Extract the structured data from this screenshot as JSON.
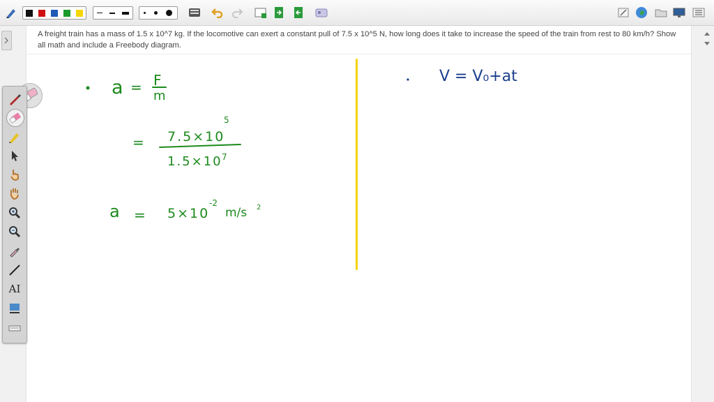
{
  "question": {
    "text": "A freight train has a mass of 1.5 x 10^7 kg. If the locomotive can exert a constant pull of 7.5 x 10^5 N, how long does it take to increase the speed of the train from rest to 80 km/h? Show all math and include a Freebody diagram."
  },
  "toolbar": {
    "colors": [
      "#111111",
      "#d01010",
      "#1f5bb5",
      "#1a9a2a",
      "#f5d600"
    ],
    "icons": [
      "pen-settings-icon",
      "keyboard-icon",
      "undo-icon",
      "redo-icon",
      "new-page-icon",
      "export-page-icon",
      "import-page-icon",
      "gallery-icon",
      "note-icon",
      "globe-icon",
      "folder-icon",
      "screen-icon",
      "menu-icon"
    ]
  },
  "palette": {
    "tools": [
      "pen-icon",
      "eraser-icon",
      "highlighter-icon",
      "pointer-icon",
      "hand-pointer-icon",
      "pan-hand-icon",
      "zoom-in-icon",
      "zoom-out-icon",
      "eyedropper-icon",
      "line-icon",
      "text-tool-icon",
      "image-tool-icon",
      "keyboard-tool-icon"
    ],
    "text_tool_label": "AI"
  },
  "handwriting": {
    "accel_formula": [
      "a",
      "=",
      "F",
      "m"
    ],
    "substitution": [
      "=",
      "7.5×10",
      "5",
      "1.5×10",
      "7"
    ],
    "accel_result": [
      "a",
      "=",
      "5×10",
      "-2",
      "m/s",
      "2"
    ],
    "velocity_formula": "V = V₀+at",
    "ink_colors": {
      "left": "#1c8a1c",
      "right": "#1a3f8c",
      "divider": "#f3d300"
    }
  }
}
